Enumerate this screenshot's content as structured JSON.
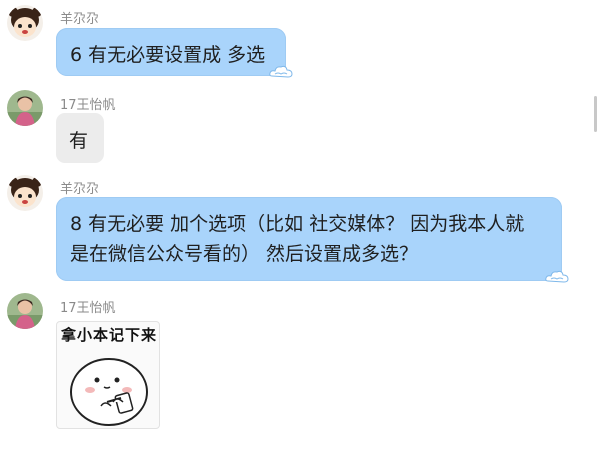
{
  "messages": [
    {
      "sender": "羊尕尕",
      "lines": [
        "6  有无必要设置成 多选"
      ],
      "avatar": "cartoon-girl-avatar",
      "bubble_color": "#a9d4fb"
    },
    {
      "sender": "17王怡帆",
      "lines": [
        "有"
      ],
      "avatar": "photo-avatar",
      "bubble_color": "#ececec"
    },
    {
      "sender": "羊尕尕",
      "lines": [
        "8  有无必要  加个选项（比如  社交媒体？ 因为我本人就",
        "是在微信公众号看的）   然后设置成多选？"
      ],
      "avatar": "cartoon-girl-avatar",
      "bubble_color": "#a9d4fb"
    },
    {
      "sender": "17王怡帆",
      "sticker_caption": "拿小本记下来",
      "avatar": "photo-avatar"
    }
  ],
  "icons": {
    "bubble_decoration": "cloud-icon",
    "sticker": "notebook-sticker"
  }
}
